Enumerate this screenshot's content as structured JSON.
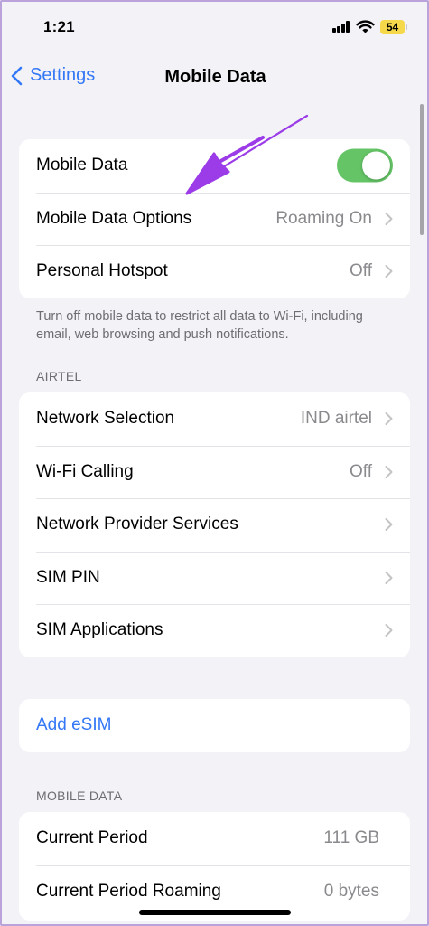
{
  "status_bar": {
    "time": "1:21",
    "battery": "54"
  },
  "nav": {
    "back_label": "Settings",
    "title": "Mobile Data"
  },
  "group1": {
    "mobile_data": {
      "label": "Mobile Data",
      "toggle_on": true
    },
    "options": {
      "label": "Mobile Data Options",
      "value": "Roaming On"
    },
    "hotspot": {
      "label": "Personal Hotspot",
      "value": "Off"
    }
  },
  "group1_footer": "Turn off mobile data to restrict all data to Wi-Fi, including email, web browsing and push notifications.",
  "carrier": {
    "header": "AIRTEL",
    "rows": [
      {
        "label": "Network Selection",
        "value": "IND airtel"
      },
      {
        "label": "Wi-Fi Calling",
        "value": "Off"
      },
      {
        "label": "Network Provider Services",
        "value": ""
      },
      {
        "label": "SIM PIN",
        "value": ""
      },
      {
        "label": "SIM Applications",
        "value": ""
      }
    ]
  },
  "esim": {
    "label": "Add eSIM"
  },
  "usage": {
    "header": "MOBILE DATA",
    "rows": [
      {
        "label": "Current Period",
        "value": "111 GB"
      },
      {
        "label": "Current Period Roaming",
        "value": "0 bytes"
      }
    ]
  },
  "colors": {
    "accent": "#3478f6",
    "toggle_on": "#65c466",
    "annotation_arrow": "#9b3ce8"
  }
}
